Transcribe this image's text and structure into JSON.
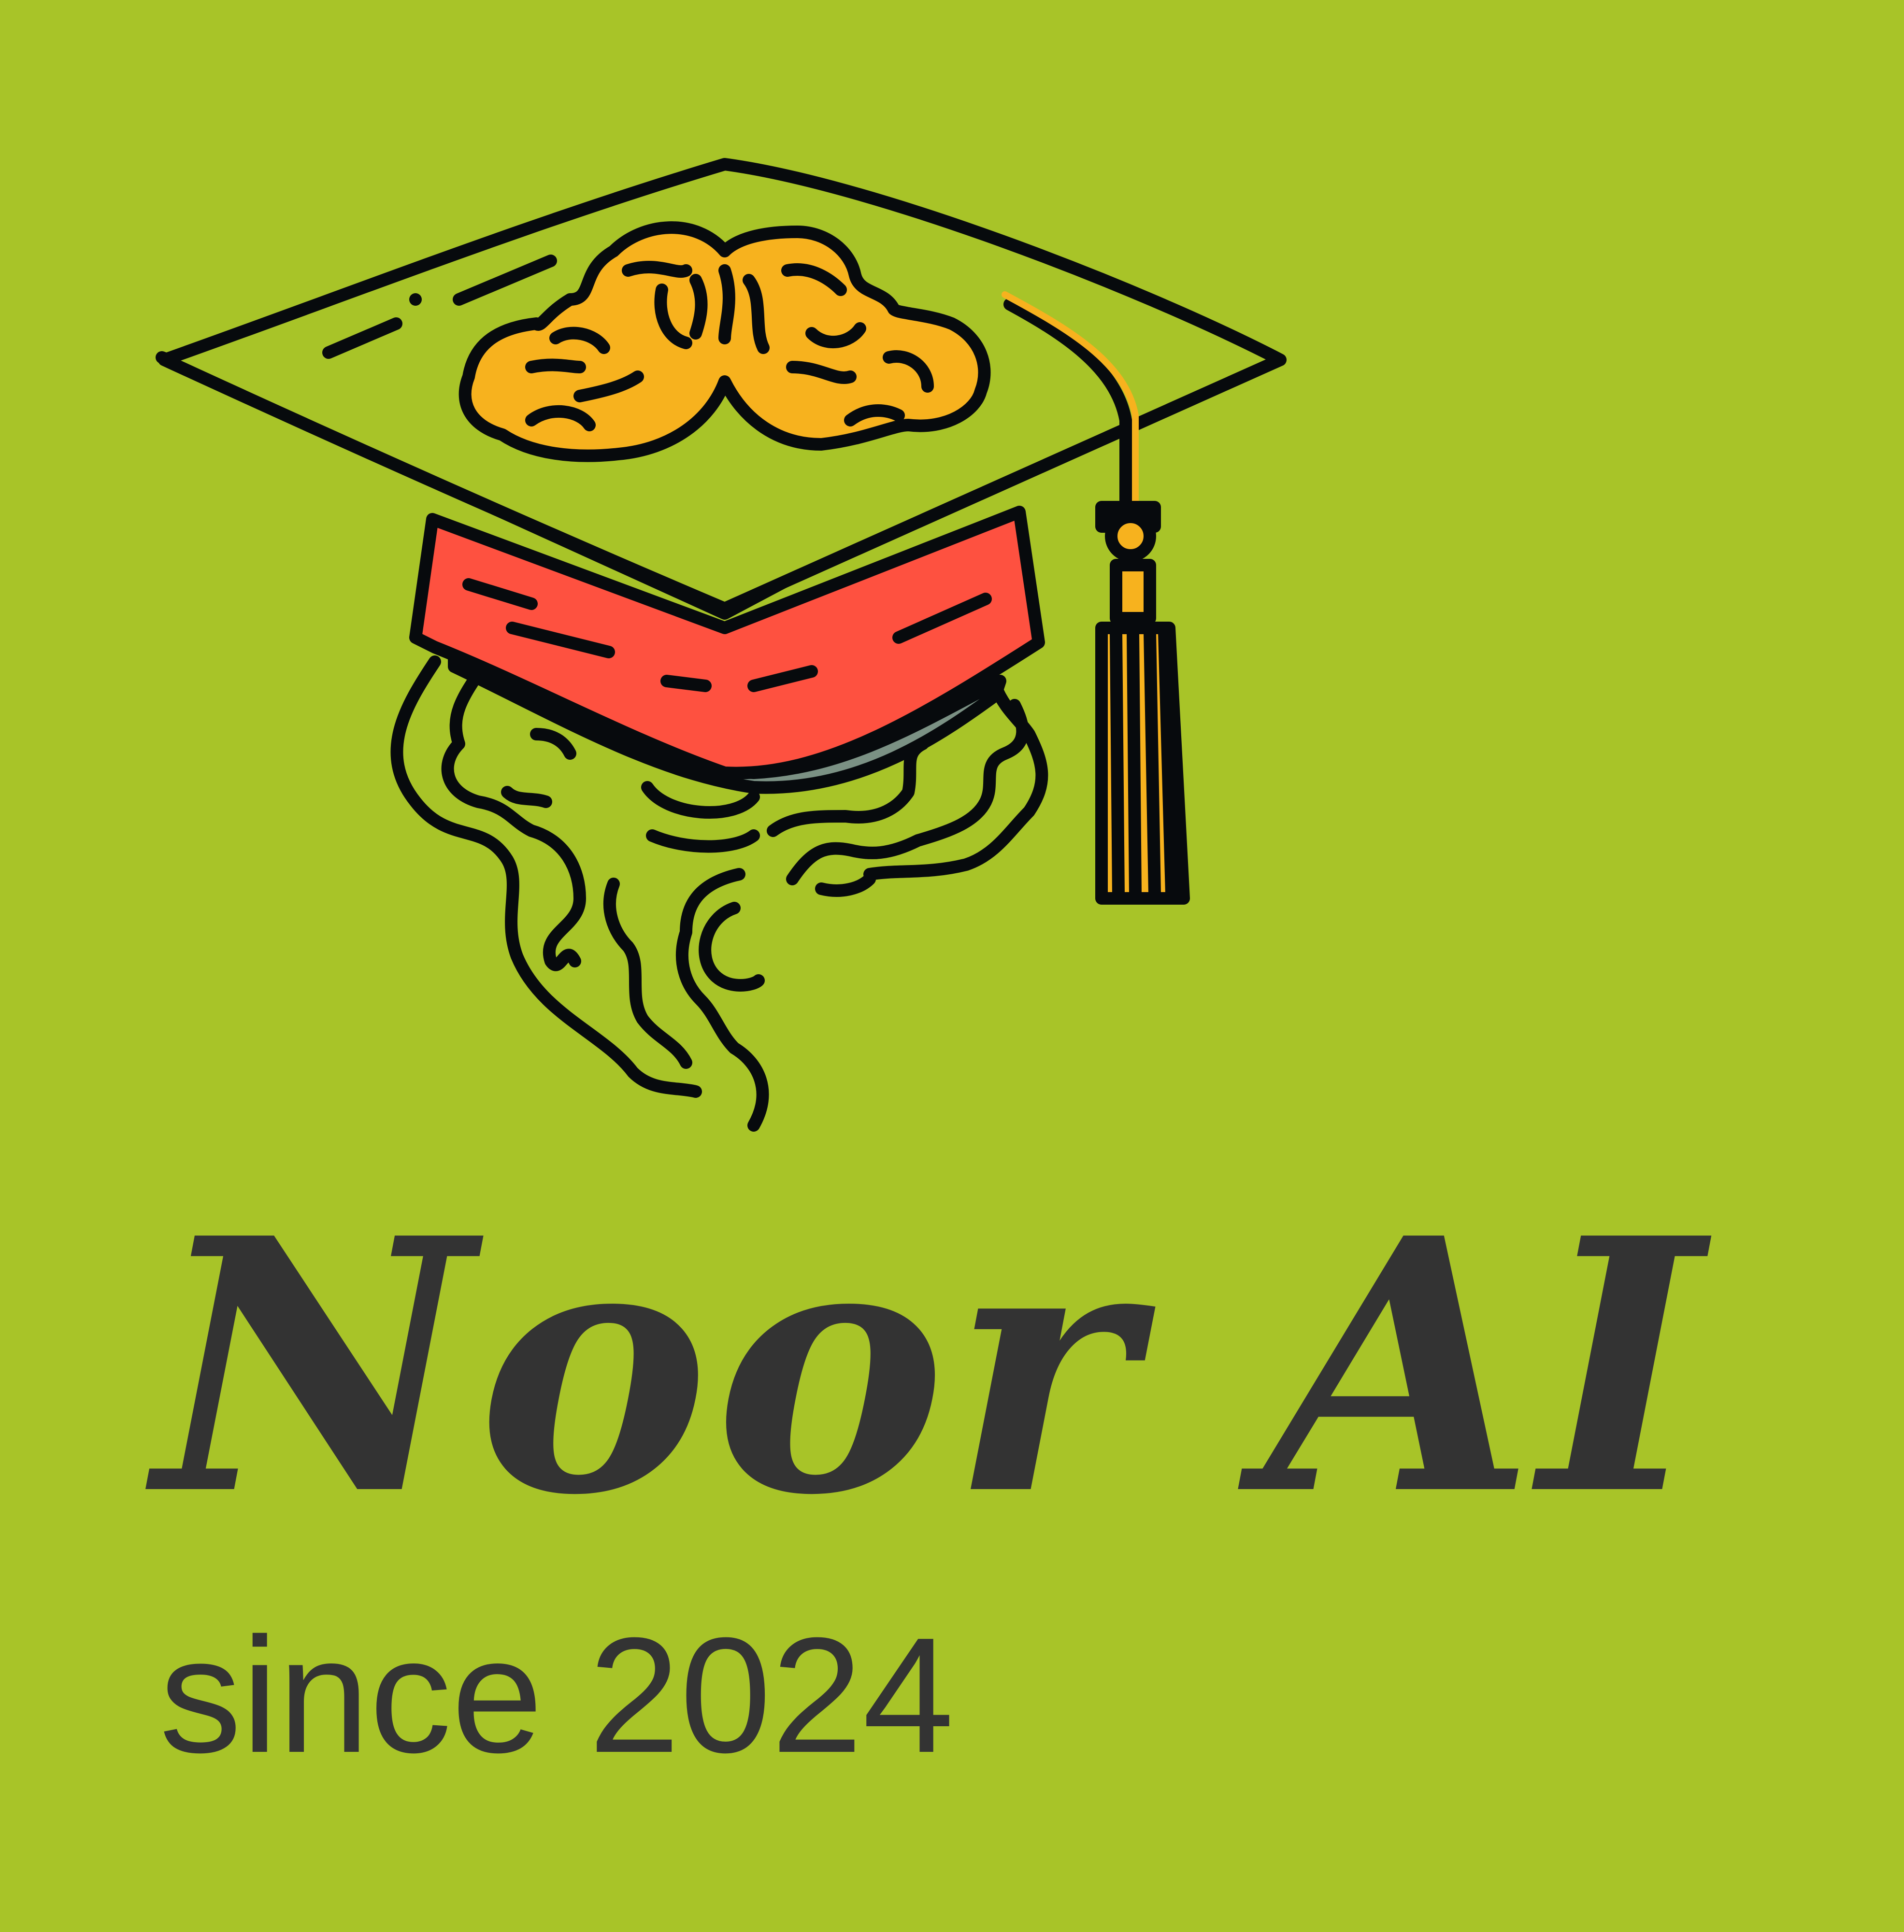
{
  "brand": {
    "name": "Noor AI",
    "tagline": "since 2024"
  },
  "colors": {
    "background": "#a8c428",
    "ink": "#070a0d",
    "text": "#333333",
    "brain": "#f7b21e",
    "cap_band": "#fe5140",
    "tassel": "#f7b21e",
    "shadow": "#7b9184"
  },
  "icons": {
    "emblem": "graduation-cap-brain-icon",
    "tassel": "tassel-icon",
    "hair": "curly-hair-icon"
  }
}
